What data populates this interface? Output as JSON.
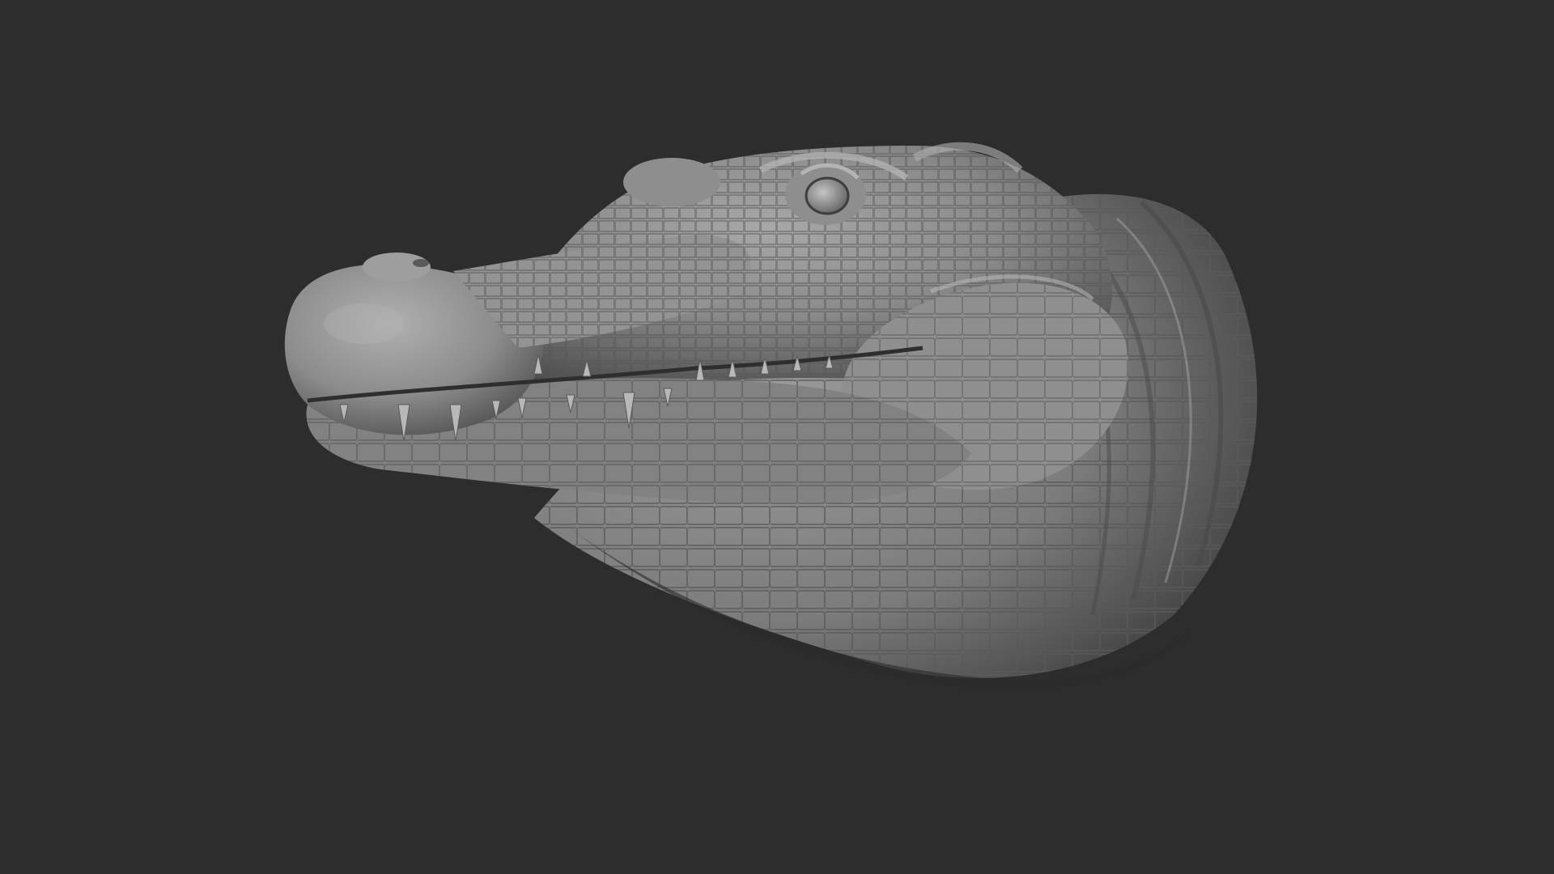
{
  "viewport": {
    "background_color": "#2d2d2d",
    "subject": "crocodile-head-sculpt",
    "material_color": "#8a8a8a",
    "highlight_color": "#bdbdbd",
    "shadow_color": "#3a3a3a"
  }
}
